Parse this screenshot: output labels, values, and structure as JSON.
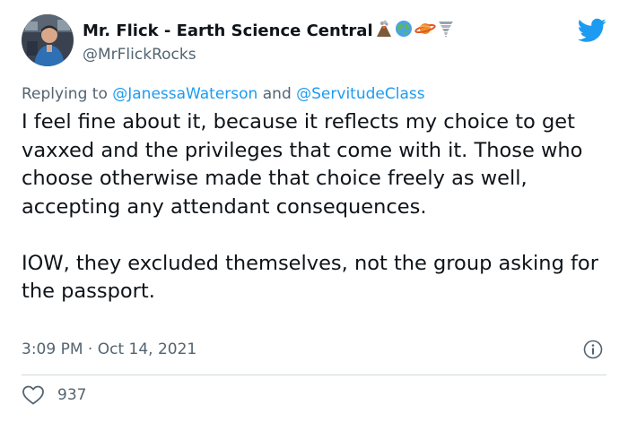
{
  "author": {
    "display_name": "Mr. Flick - Earth Science Central",
    "emojis": [
      "🌋",
      "🌎",
      "🪐",
      "🌪"
    ],
    "handle": "@MrFlickRocks"
  },
  "reply": {
    "prefix": "Replying to",
    "mention_1": "@JanessaWaterson",
    "conjunction": "and",
    "mention_2": "@ServitudeClass"
  },
  "tweet": {
    "paragraph_1": "I feel fine about it, because it reflects my choice to get vaxxed and the privileges that come with it. Those who choose otherwise made that choice freely as well, accepting any attendant consequences.",
    "paragraph_2": "IOW, they excluded themselves, not the group asking for the passport."
  },
  "meta": {
    "time": "3:09 PM",
    "separator": "·",
    "date": "Oct 14, 2021"
  },
  "engagement": {
    "likes": "937"
  },
  "icons": {
    "logo": "twitter-bird-icon",
    "info": "info-icon",
    "like": "heart-icon"
  },
  "colors": {
    "brand_blue": "#1d9bf0",
    "text_primary": "#0f1419",
    "text_secondary": "#536471",
    "divider": "#cfd9de"
  }
}
